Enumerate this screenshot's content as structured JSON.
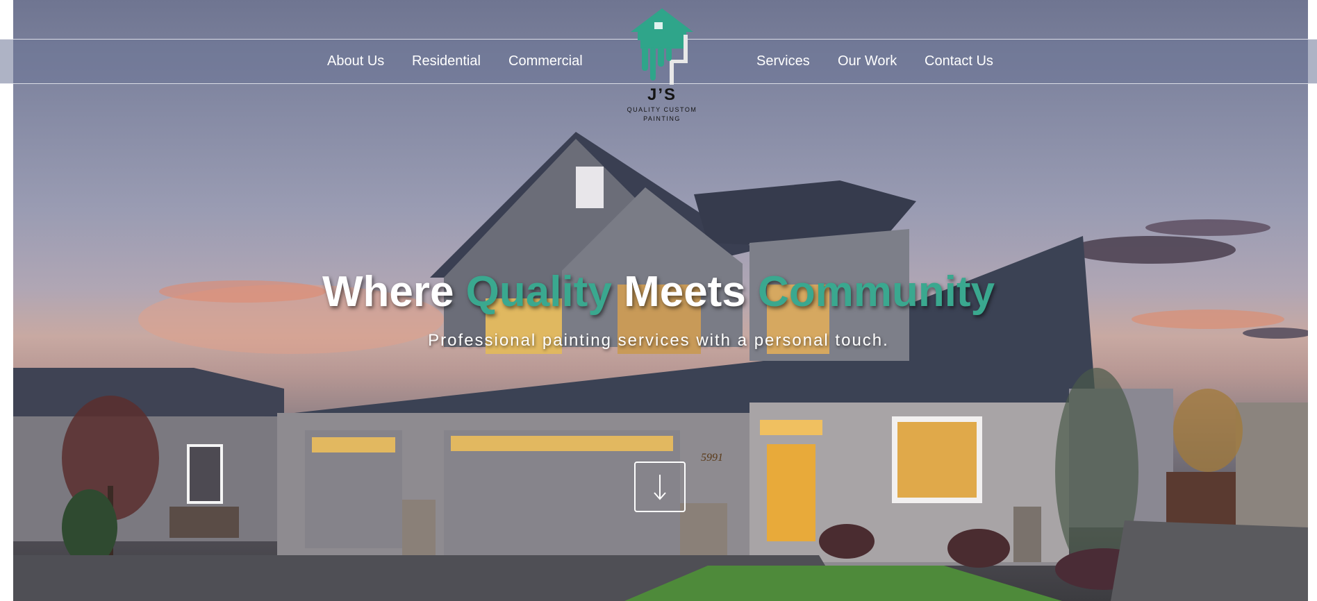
{
  "brand": {
    "logo_title": "J’S",
    "logo_subtitle_line1": "QUALITY CUSTOM",
    "logo_subtitle_line2": "PAINTING",
    "accent_color": "#3aa88f"
  },
  "nav": {
    "left": [
      "About Us",
      "Residential",
      "Commercial"
    ],
    "right": [
      "Services",
      "Our Work",
      "Contact Us"
    ]
  },
  "hero": {
    "headline_word1": "Where",
    "headline_word2": "Quality",
    "headline_word3": "Meets",
    "headline_word4": "Community",
    "subheadline": "Professional painting services with a personal touch.",
    "house_number": "5991",
    "scroll_icon": "arrow-down-icon"
  }
}
